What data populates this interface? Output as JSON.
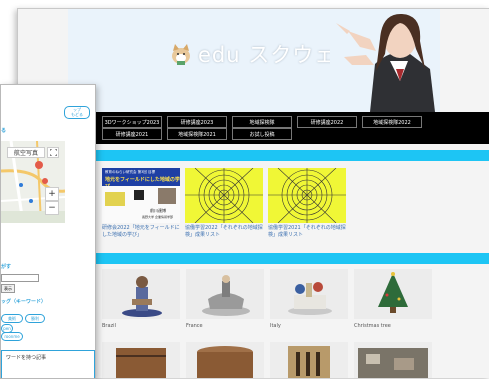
{
  "site": {
    "logo_text": "edu スクウェア"
  },
  "nav": {
    "row1": [
      "3Dワークショップ2023",
      "研修講座2023",
      "地域探検隊",
      "研修講座2022",
      "地域探検隊2022"
    ],
    "row2": [
      "研修講座2021",
      "地域探検隊2021",
      "お試し投稿"
    ]
  },
  "cards": [
    {
      "caption": "研修会2022「地元をフィールドにした地域の学び」",
      "banner_top": "教育のねらい研究会  第3回  目標",
      "banner_title": "地元をフィールドにした地域の学び",
      "speaker": "前川達博",
      "speaker_sub": "長野大学 企業情報学部"
    },
    {
      "caption": "協働学習2022「それぞれの地域探検」成果リスト"
    },
    {
      "caption": "協働学習2021「それぞれの地域探検」成果リスト"
    }
  ],
  "photos": [
    {
      "caption": "Brazil"
    },
    {
      "caption": "France"
    },
    {
      "caption": "Italy"
    },
    {
      "caption": "Christmas tree"
    }
  ],
  "panel": {
    "top_button": "ップ\nもどる",
    "map_section": "る",
    "map_type": "航空写真",
    "fullscreen_icon": "fullscreen-icon",
    "zoom_in": "+",
    "zoom_out": "−",
    "search_section": "がす",
    "search_button": "表示",
    "tag_section": "ッグ（キーワード）",
    "tags": [
      "美術",
      "勝利",
      "pen",
      "roonme"
    ],
    "articles_box": "ワードを持つ記事"
  },
  "colors": {
    "band": "#1dc5f4",
    "nav": "#000000",
    "accent": "#2fa3da",
    "web_yellow": "#f0f736"
  }
}
